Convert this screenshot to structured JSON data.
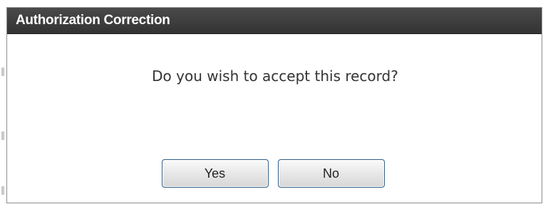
{
  "dialog": {
    "title": "Authorization Correction",
    "message": "Do you wish to accept this record?",
    "buttons": {
      "yes_label": "Yes",
      "no_label": "No"
    }
  },
  "colors": {
    "titlebar_bg": "#3a3a3a",
    "titlebar_text": "#ffffff",
    "button_border": "#2e5d86"
  }
}
